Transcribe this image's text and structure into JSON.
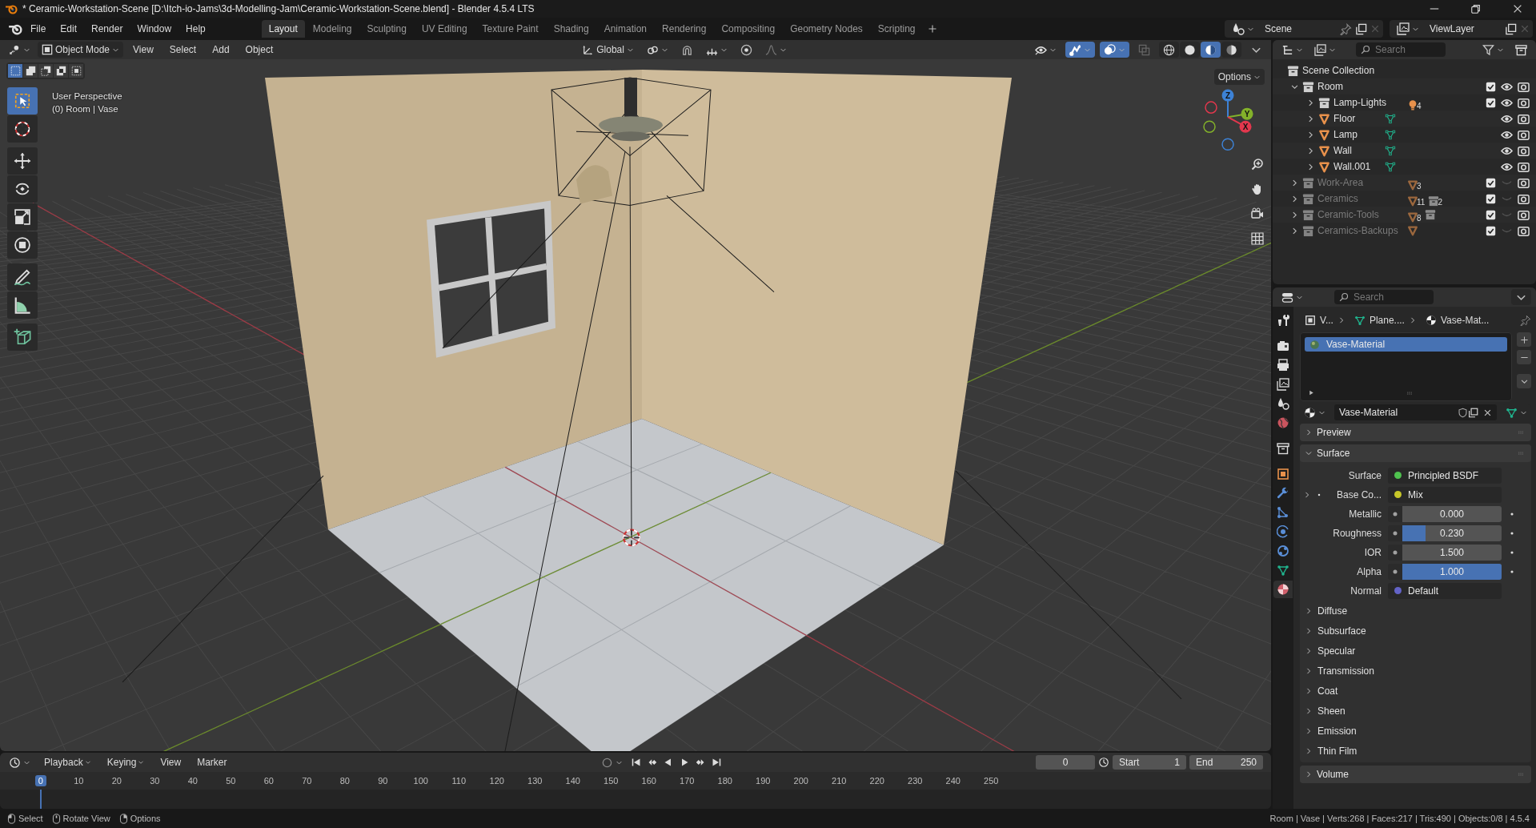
{
  "window": {
    "title": "* Ceramic-Workstation-Scene [D:\\Itch-io-Jams\\3d-Modelling-Jam\\Ceramic-Workstation-Scene.blend] - Blender 4.5.4 LTS"
  },
  "menu": [
    "File",
    "Edit",
    "Render",
    "Window",
    "Help"
  ],
  "workspaces": [
    {
      "label": "Layout",
      "selected": true
    },
    {
      "label": "Modeling",
      "selected": false
    },
    {
      "label": "Sculpting",
      "selected": false
    },
    {
      "label": "UV Editing",
      "selected": false
    },
    {
      "label": "Texture Paint",
      "selected": false
    },
    {
      "label": "Shading",
      "selected": false
    },
    {
      "label": "Animation",
      "selected": false
    },
    {
      "label": "Rendering",
      "selected": false
    },
    {
      "label": "Compositing",
      "selected": false
    },
    {
      "label": "Geometry Nodes",
      "selected": false
    },
    {
      "label": "Scripting",
      "selected": false
    }
  ],
  "scene": {
    "name": "Scene"
  },
  "view_layer": {
    "name": "ViewLayer"
  },
  "viewport": {
    "mode": "Object Mode",
    "menus": [
      "View",
      "Select",
      "Add",
      "Object"
    ],
    "orientation": "Global",
    "options": "Options",
    "info": [
      "User Perspective",
      "(0) Room | Vase"
    ],
    "select_modes": [
      {
        "selected": true
      },
      {
        "selected": false
      },
      {
        "selected": false
      },
      {
        "selected": false
      },
      {
        "selected": false
      }
    ],
    "tools": [
      {
        "selected": true
      },
      {
        "selected": false
      },
      {
        "selected": false
      },
      {
        "selected": false
      },
      {
        "selected": false
      },
      {
        "selected": false
      },
      {
        "selected": false
      },
      {
        "selected": false
      },
      {
        "selected": false
      }
    ],
    "show_gizmos": true,
    "overlays_on": true,
    "shading": [
      {
        "selected": false
      },
      {
        "selected": false
      },
      {
        "selected": true
      },
      {
        "selected": false
      }
    ],
    "gizmo_axes": [
      {
        "label": "Z",
        "color": "#3d82d6"
      },
      {
        "label": "Y",
        "color": "#83b12a"
      },
      {
        "label": "X",
        "color": "#e2374d"
      }
    ]
  },
  "outliner": {
    "search_placeholder": "Search",
    "root": "Scene Collection",
    "items": [
      {
        "name": "Room",
        "kind": "collection",
        "expanded": true,
        "visible": true,
        "checked": true,
        "children": [
          {
            "name": "Lamp-Lights",
            "kind": "collection",
            "expanded": false,
            "visible": true,
            "checked": true,
            "badges": [
              {
                "kind": "light",
                "count": "4"
              }
            ]
          },
          {
            "name": "Floor",
            "kind": "object",
            "expanded": false,
            "visible": true,
            "badges": [
              {
                "kind": "mesh"
              }
            ]
          },
          {
            "name": "Lamp",
            "kind": "object",
            "expanded": false,
            "visible": true,
            "badges": [
              {
                "kind": "mesh"
              }
            ]
          },
          {
            "name": "Wall",
            "kind": "object",
            "expanded": false,
            "visible": true,
            "badges": [
              {
                "kind": "mesh"
              }
            ]
          },
          {
            "name": "Wall.001",
            "kind": "object",
            "expanded": false,
            "visible": true,
            "badges": [
              {
                "kind": "mesh"
              }
            ]
          }
        ]
      },
      {
        "name": "Work-Area",
        "kind": "collection",
        "expanded": false,
        "visible": false,
        "checked": true,
        "badges": [
          {
            "kind": "object",
            "count": "3"
          }
        ]
      },
      {
        "name": "Ceramics",
        "kind": "collection",
        "expanded": false,
        "visible": false,
        "checked": true,
        "badges": [
          {
            "kind": "object",
            "count": "11"
          },
          {
            "kind": "collection",
            "count": "2"
          }
        ]
      },
      {
        "name": "Ceramic-Tools",
        "kind": "collection",
        "expanded": false,
        "visible": false,
        "checked": true,
        "badges": [
          {
            "kind": "object",
            "count": "8"
          },
          {
            "kind": "collection"
          }
        ]
      },
      {
        "name": "Ceramics-Backups",
        "kind": "collection",
        "expanded": false,
        "visible": false,
        "checked": true,
        "badges": [
          {
            "kind": "object"
          }
        ]
      }
    ]
  },
  "properties": {
    "search_placeholder": "Search",
    "tabs": [
      {
        "selected": false
      },
      {
        "selected": false
      },
      {
        "selected": false
      },
      {
        "selected": false
      },
      {
        "selected": false
      },
      {
        "selected": false
      },
      {
        "selected": false
      },
      {
        "selected": false
      },
      {
        "selected": false
      },
      {
        "selected": false
      },
      {
        "selected": false
      },
      {
        "selected": false
      },
      {
        "selected": false
      },
      {
        "selected": true
      }
    ],
    "breadcrumb": [
      "V...",
      "Plane....",
      "Vase-Mat..."
    ],
    "slots": [
      {
        "name": "Vase-Material",
        "selected": true
      }
    ],
    "material": "Vase-Material",
    "panels": [
      {
        "title": "Preview",
        "expanded": false
      },
      {
        "title": "Surface",
        "expanded": true,
        "fields": [
          {
            "kind": "link",
            "label": "Surface",
            "value": "Principled BSDF",
            "color": "#4fc24f"
          },
          {
            "kind": "link",
            "label": "Base Co...",
            "value": "Mix",
            "color": "#c7c729",
            "expandable": true
          },
          {
            "kind": "slider",
            "label": "Metallic",
            "value": "0.000",
            "level": 0
          },
          {
            "kind": "slider",
            "label": "Roughness",
            "value": "0.230",
            "level": 0.23
          },
          {
            "kind": "slider",
            "label": "IOR",
            "value": "1.500",
            "level": 0
          },
          {
            "kind": "slider",
            "label": "Alpha",
            "value": "1.000",
            "level": 1
          },
          {
            "kind": "link",
            "label": "Normal",
            "value": "Default",
            "color": "#6363c7"
          }
        ],
        "sections": [
          {
            "title": "Diffuse",
            "expanded": false
          },
          {
            "title": "Subsurface",
            "expanded": false
          },
          {
            "title": "Specular",
            "expanded": false
          },
          {
            "title": "Transmission",
            "expanded": false
          },
          {
            "title": "Coat",
            "expanded": false
          },
          {
            "title": "Sheen",
            "expanded": false
          },
          {
            "title": "Emission",
            "expanded": false
          },
          {
            "title": "Thin Film",
            "expanded": false
          }
        ]
      },
      {
        "title": "Volume",
        "expanded": false
      }
    ]
  },
  "timeline": {
    "auto_keying": false,
    "menus": [
      "Playback",
      "Keying",
      "View",
      "Marker"
    ],
    "current_frame": "0",
    "start_label": "Start",
    "start": "1",
    "end_label": "End",
    "end": "250",
    "ruler": [
      {
        "label": "0",
        "selected": true
      },
      {
        "label": "10",
        "selected": false
      },
      {
        "label": "20",
        "selected": false
      },
      {
        "label": "30",
        "selected": false
      },
      {
        "label": "40",
        "selected": false
      },
      {
        "label": "50",
        "selected": false
      },
      {
        "label": "60",
        "selected": false
      },
      {
        "label": "70",
        "selected": false
      },
      {
        "label": "80",
        "selected": false
      },
      {
        "label": "90",
        "selected": false
      },
      {
        "label": "100",
        "selected": false
      },
      {
        "label": "110",
        "selected": false
      },
      {
        "label": "120",
        "selected": false
      },
      {
        "label": "130",
        "selected": false
      },
      {
        "label": "140",
        "selected": false
      },
      {
        "label": "150",
        "selected": false
      },
      {
        "label": "160",
        "selected": false
      },
      {
        "label": "170",
        "selected": false
      },
      {
        "label": "180",
        "selected": false
      },
      {
        "label": "190",
        "selected": false
      },
      {
        "label": "200",
        "selected": false
      },
      {
        "label": "210",
        "selected": false
      },
      {
        "label": "220",
        "selected": false
      },
      {
        "label": "230",
        "selected": false
      },
      {
        "label": "240",
        "selected": false
      },
      {
        "label": "250",
        "selected": false
      }
    ]
  },
  "status_bar": {
    "hints": [
      "Select",
      "Rotate View",
      "Options"
    ],
    "stats": "Room | Vase | Verts:268 | Faces:217 | Tris:490 | Objects:0/8 | 4.5.4"
  }
}
